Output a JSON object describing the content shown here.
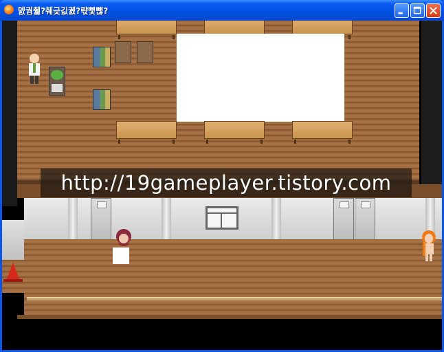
{
  "window": {
    "title": "덼궘췙?췌긎깂궰?랷뼟뺂?",
    "controls": {
      "minimize_icon": "minimize-icon",
      "maximize_icon": "maximize-icon",
      "close_icon": "close-icon"
    }
  },
  "game": {
    "watermark_text": "http://19gameplayer.tistory.com",
    "scene": {
      "upper_area": "classroom",
      "lower_area": "hallway"
    }
  },
  "colors": {
    "titlebar": "#0a5cf0",
    "floor": "#a97548",
    "whiteboard": "#ffffff",
    "wall": "#d8d8d8",
    "cone": "#d42a1a"
  }
}
